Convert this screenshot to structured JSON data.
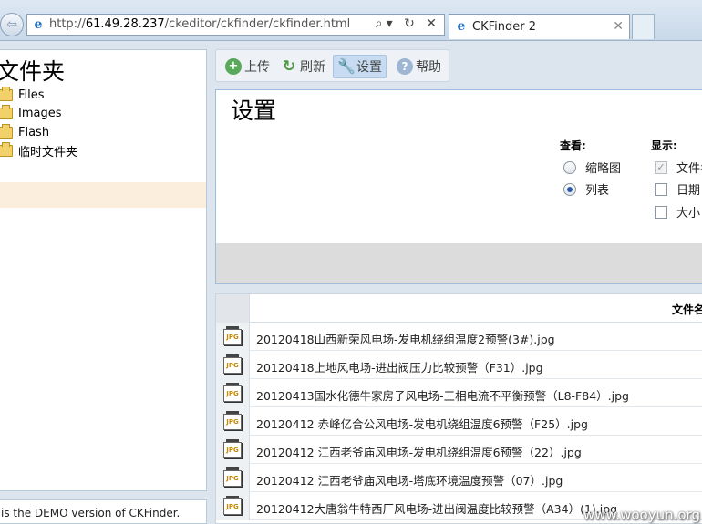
{
  "browser": {
    "url_prefix": "http://",
    "url_host": "61.49.28.237",
    "url_path": "/ckeditor/ckfinder/ckfinder.html",
    "address_controls": "⌕▾ ↻ ✕",
    "tab_title": "CKFinder 2",
    "tab_close": "✕",
    "back_glyph": "⇦"
  },
  "folders": {
    "title": "文件夹",
    "items": [
      {
        "label": "Files"
      },
      {
        "label": "Images"
      },
      {
        "label": "Flash"
      },
      {
        "label": "临时文件夹"
      }
    ]
  },
  "demo_notice": "is the DEMO version of CKFinder.",
  "toolbar": {
    "upload": "上传",
    "refresh": "刷新",
    "settings": "设置",
    "help": "帮助",
    "upload_glyph": "+",
    "refresh_glyph": "↻",
    "settings_glyph": "🔧",
    "help_glyph": "?"
  },
  "settings": {
    "title": "设置",
    "view_label": "查看:",
    "view_options": [
      {
        "label": "缩略图",
        "selected": false
      },
      {
        "label": "列表",
        "selected": true
      }
    ],
    "show_label": "显示:",
    "show_options": [
      {
        "label": "文件名",
        "checked": true,
        "disabled": true
      },
      {
        "label": "日期",
        "checked": false
      },
      {
        "label": "大小",
        "checked": false
      }
    ]
  },
  "file_list": {
    "header_name": "文件名",
    "icon_text": "JPG",
    "files": [
      {
        "name": "20120418山西新荣风电场-发电机绕组温度2预警(3#).jpg"
      },
      {
        "name": "20120418上地风电场-进出阀压力比较预警（F31）.jpg"
      },
      {
        "name": "20120413国水化德牛家房子风电场-三相电流不平衡预警（L8-F84）.jpg"
      },
      {
        "name": "20120412 赤峰亿合公风电场-发电机绕组温度6预警（F25）.jpg"
      },
      {
        "name": "20120412 江西老爷庙风电场-发电机绕组温度6预警（22）.jpg"
      },
      {
        "name": "20120412 江西老爷庙风电场-塔底环境温度预警（07）.jpg"
      },
      {
        "name": "20120412大唐翁牛特西厂风电场-进出阀温度比较预警（A34）(1).jpg"
      }
    ]
  },
  "watermark": "www.wooyun.org"
}
